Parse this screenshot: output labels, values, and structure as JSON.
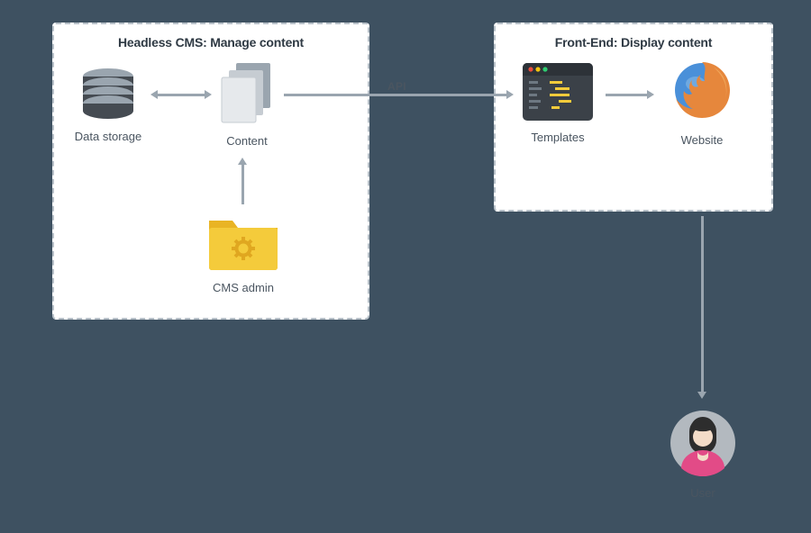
{
  "panels": {
    "left": {
      "title": "Headless CMS: Manage content"
    },
    "right": {
      "title": "Front-End: Display content"
    }
  },
  "nodes": {
    "storage": {
      "label": "Data storage"
    },
    "content": {
      "label": "Content"
    },
    "admin": {
      "label": "CMS admin"
    },
    "templates": {
      "label": "Templates"
    },
    "website": {
      "label": "Website"
    },
    "user": {
      "label": "User"
    }
  },
  "edges": {
    "api_label": "API"
  }
}
